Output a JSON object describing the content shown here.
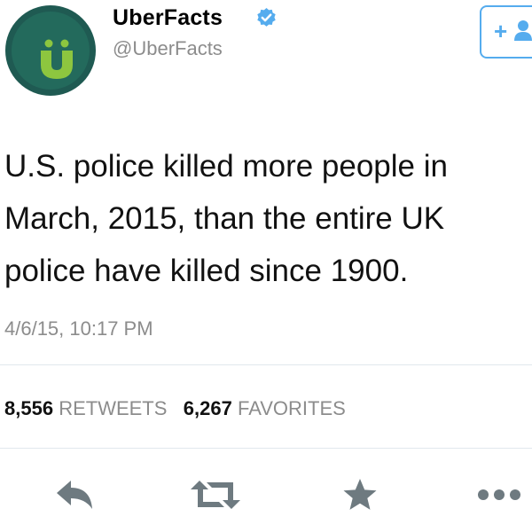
{
  "user": {
    "name": "UberFacts",
    "handle": "@UberFacts",
    "verified": true
  },
  "follow_button": {
    "icon": "add-user-icon",
    "label": "+"
  },
  "tweet": {
    "text_lines": [
      "U.S. police killed more people in",
      "March, 2015, than the entire UK",
      "police have killed since 1900."
    ],
    "timestamp": "4/6/15, 10:17 PM"
  },
  "stats": {
    "retweets_count": "8,556",
    "retweets_label": "RETWEETS",
    "favorites_count": "6,267",
    "favorites_label": "FAVORITES"
  },
  "actions": [
    {
      "name": "reply",
      "icon": "reply-icon"
    },
    {
      "name": "retweet",
      "icon": "retweet-icon"
    },
    {
      "name": "favorite",
      "icon": "star-icon"
    },
    {
      "name": "more",
      "icon": "more-icon"
    }
  ],
  "colors": {
    "accent": "#55acee",
    "avatar_dark": "#1f5a52",
    "avatar_green": "#8dc63f",
    "muted_text": "#8c8c8c",
    "action_icons": "#6e7a80"
  }
}
